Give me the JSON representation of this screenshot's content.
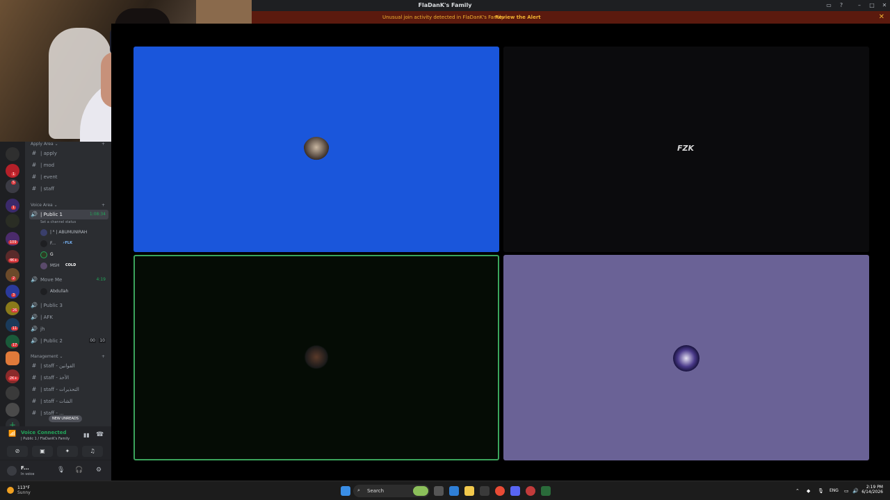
{
  "window": {
    "title": "FlaDanK's Family"
  },
  "alert": {
    "message": "Unusual join activity detected in FlaDanK's Family",
    "action": "Review the Alert"
  },
  "rail": {
    "badges": [
      "1",
      "5",
      "1",
      "109",
      "4K+",
      "2",
      "3",
      "26",
      "11",
      "17",
      "2K+"
    ]
  },
  "categories": {
    "apply_area": "Apply Area",
    "voice_area": "Voice Area",
    "management": "Management"
  },
  "apply_channels": [
    "| apply",
    "| mod",
    "| event",
    "| staff"
  ],
  "voice_channels": {
    "public1": {
      "label": "| Public 1",
      "time": "1:08:34",
      "status": "Set a channel status"
    },
    "public1_users": [
      {
        "name": "| ᴿ | ABUMUNIRAH",
        "tag": ""
      },
      {
        "name": "F...",
        "tag": "⚡FLK"
      },
      {
        "name": "G",
        "tag": ""
      },
      {
        "name": "MSH",
        "tag": "COLD"
      }
    ],
    "moveme": {
      "label": "Move Me",
      "time": "4:19"
    },
    "moveme_users": [
      {
        "name": "Abdullah"
      }
    ],
    "public3": "| Public 3",
    "afk": "| AFK",
    "jh": "jh",
    "public2": {
      "label": "| Public 2",
      "count_a": "00",
      "count_b": "10"
    }
  },
  "management_channels": [
    "| staff - القوانين",
    "| staff - الأخذ",
    "| staff - التحذيرات",
    "| staff - الشات",
    "| staff - ..."
  ],
  "new_unreads": "NEW UNREADS",
  "voice_panel": {
    "status": "Voice Connected",
    "channel": "| Public 1 / FlaDanK's Family"
  },
  "user_panel": {
    "name": "F...",
    "status": "In voice"
  },
  "tiles": {
    "top_right_logo": "FZK"
  },
  "taskbar": {
    "temp": "113°F",
    "condition": "Sunny",
    "search": "Search",
    "lang": "ENG",
    "time": "2:19 PM",
    "date": "6/14/2026"
  },
  "colors": {
    "tile_blue": "#1a56db",
    "tile_dark": "#0b0b0d",
    "tile_green_dark": "#050c05",
    "tile_speaking_border": "#3ba55c",
    "tile_purple": "#6a6296",
    "voice_green": "#23a55a"
  }
}
